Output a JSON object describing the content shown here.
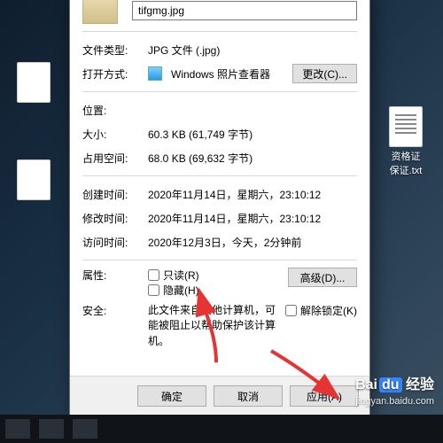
{
  "desktop": {
    "right_icon_label": "资格证\n保证.txt"
  },
  "dialog": {
    "filename": "tifgmg.jpg",
    "labels": {
      "filetype": "文件类型:",
      "openwith": "打开方式:",
      "location": "位置:",
      "size": "大小:",
      "ondisk": "占用空间:",
      "created": "创建时间:",
      "modified": "修改时间:",
      "accessed": "访问时间:",
      "attributes": "属性:",
      "security": "安全:"
    },
    "values": {
      "filetype": "JPG 文件 (.jpg)",
      "openwith_app": "Windows 照片查看器",
      "location": "",
      "size": "60.3 KB (61,749 字节)",
      "ondisk": "68.0 KB (69,632 字节)",
      "created": "2020年11月14日，星期六，23:10:12",
      "modified": "2020年11月14日，星期六，23:10:12",
      "accessed": "2020年12月3日，今天，2分钟前",
      "security_text": "此文件来自其他计算机，可能被阻止以帮助保护该计算机。"
    },
    "checkboxes": {
      "readonly": "只读(R)",
      "hidden": "隐藏(H)",
      "unblock": "解除锁定(K)"
    },
    "buttons": {
      "change": "更改(C)...",
      "advanced": "高级(D)...",
      "ok": "确定",
      "cancel": "取消",
      "apply": "应用(A)"
    }
  },
  "watermark": {
    "brand_a": "Bai",
    "brand_b": "du",
    "brand_tail": "经验",
    "sub": "jingyan.baidu.com"
  }
}
